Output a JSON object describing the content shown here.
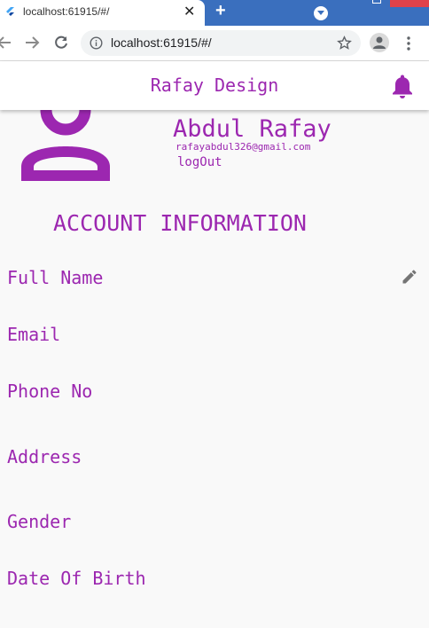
{
  "browser": {
    "tab": {
      "title": "localhost:61915/#/",
      "favicon": "flutter-icon",
      "close_label": "✕"
    },
    "new_tab_label": "+",
    "address_bar": {
      "url": "localhost:61915/#/"
    },
    "icons": [
      "back-arrow-icon",
      "forward-arrow-icon",
      "reload-icon",
      "info-icon",
      "star-icon",
      "profile-icon",
      "menu-dots-icon",
      "tab-dropdown-icon"
    ]
  },
  "app": {
    "title": "Rafay Design",
    "accent_color": "#9c27b0",
    "notification_icon": "bell-icon"
  },
  "profile": {
    "avatar_icon": "person-icon",
    "name": "Abdul Rafay",
    "email": "rafayabdul326@gmail.com",
    "logout_label": "logOut"
  },
  "account": {
    "section_title": "ACCOUNT INFORMATION",
    "edit_icon": "pencil-icon",
    "fields": [
      "Full Name",
      "Email",
      "Phone No",
      "Address",
      "Gender",
      "Date Of Birth"
    ]
  }
}
